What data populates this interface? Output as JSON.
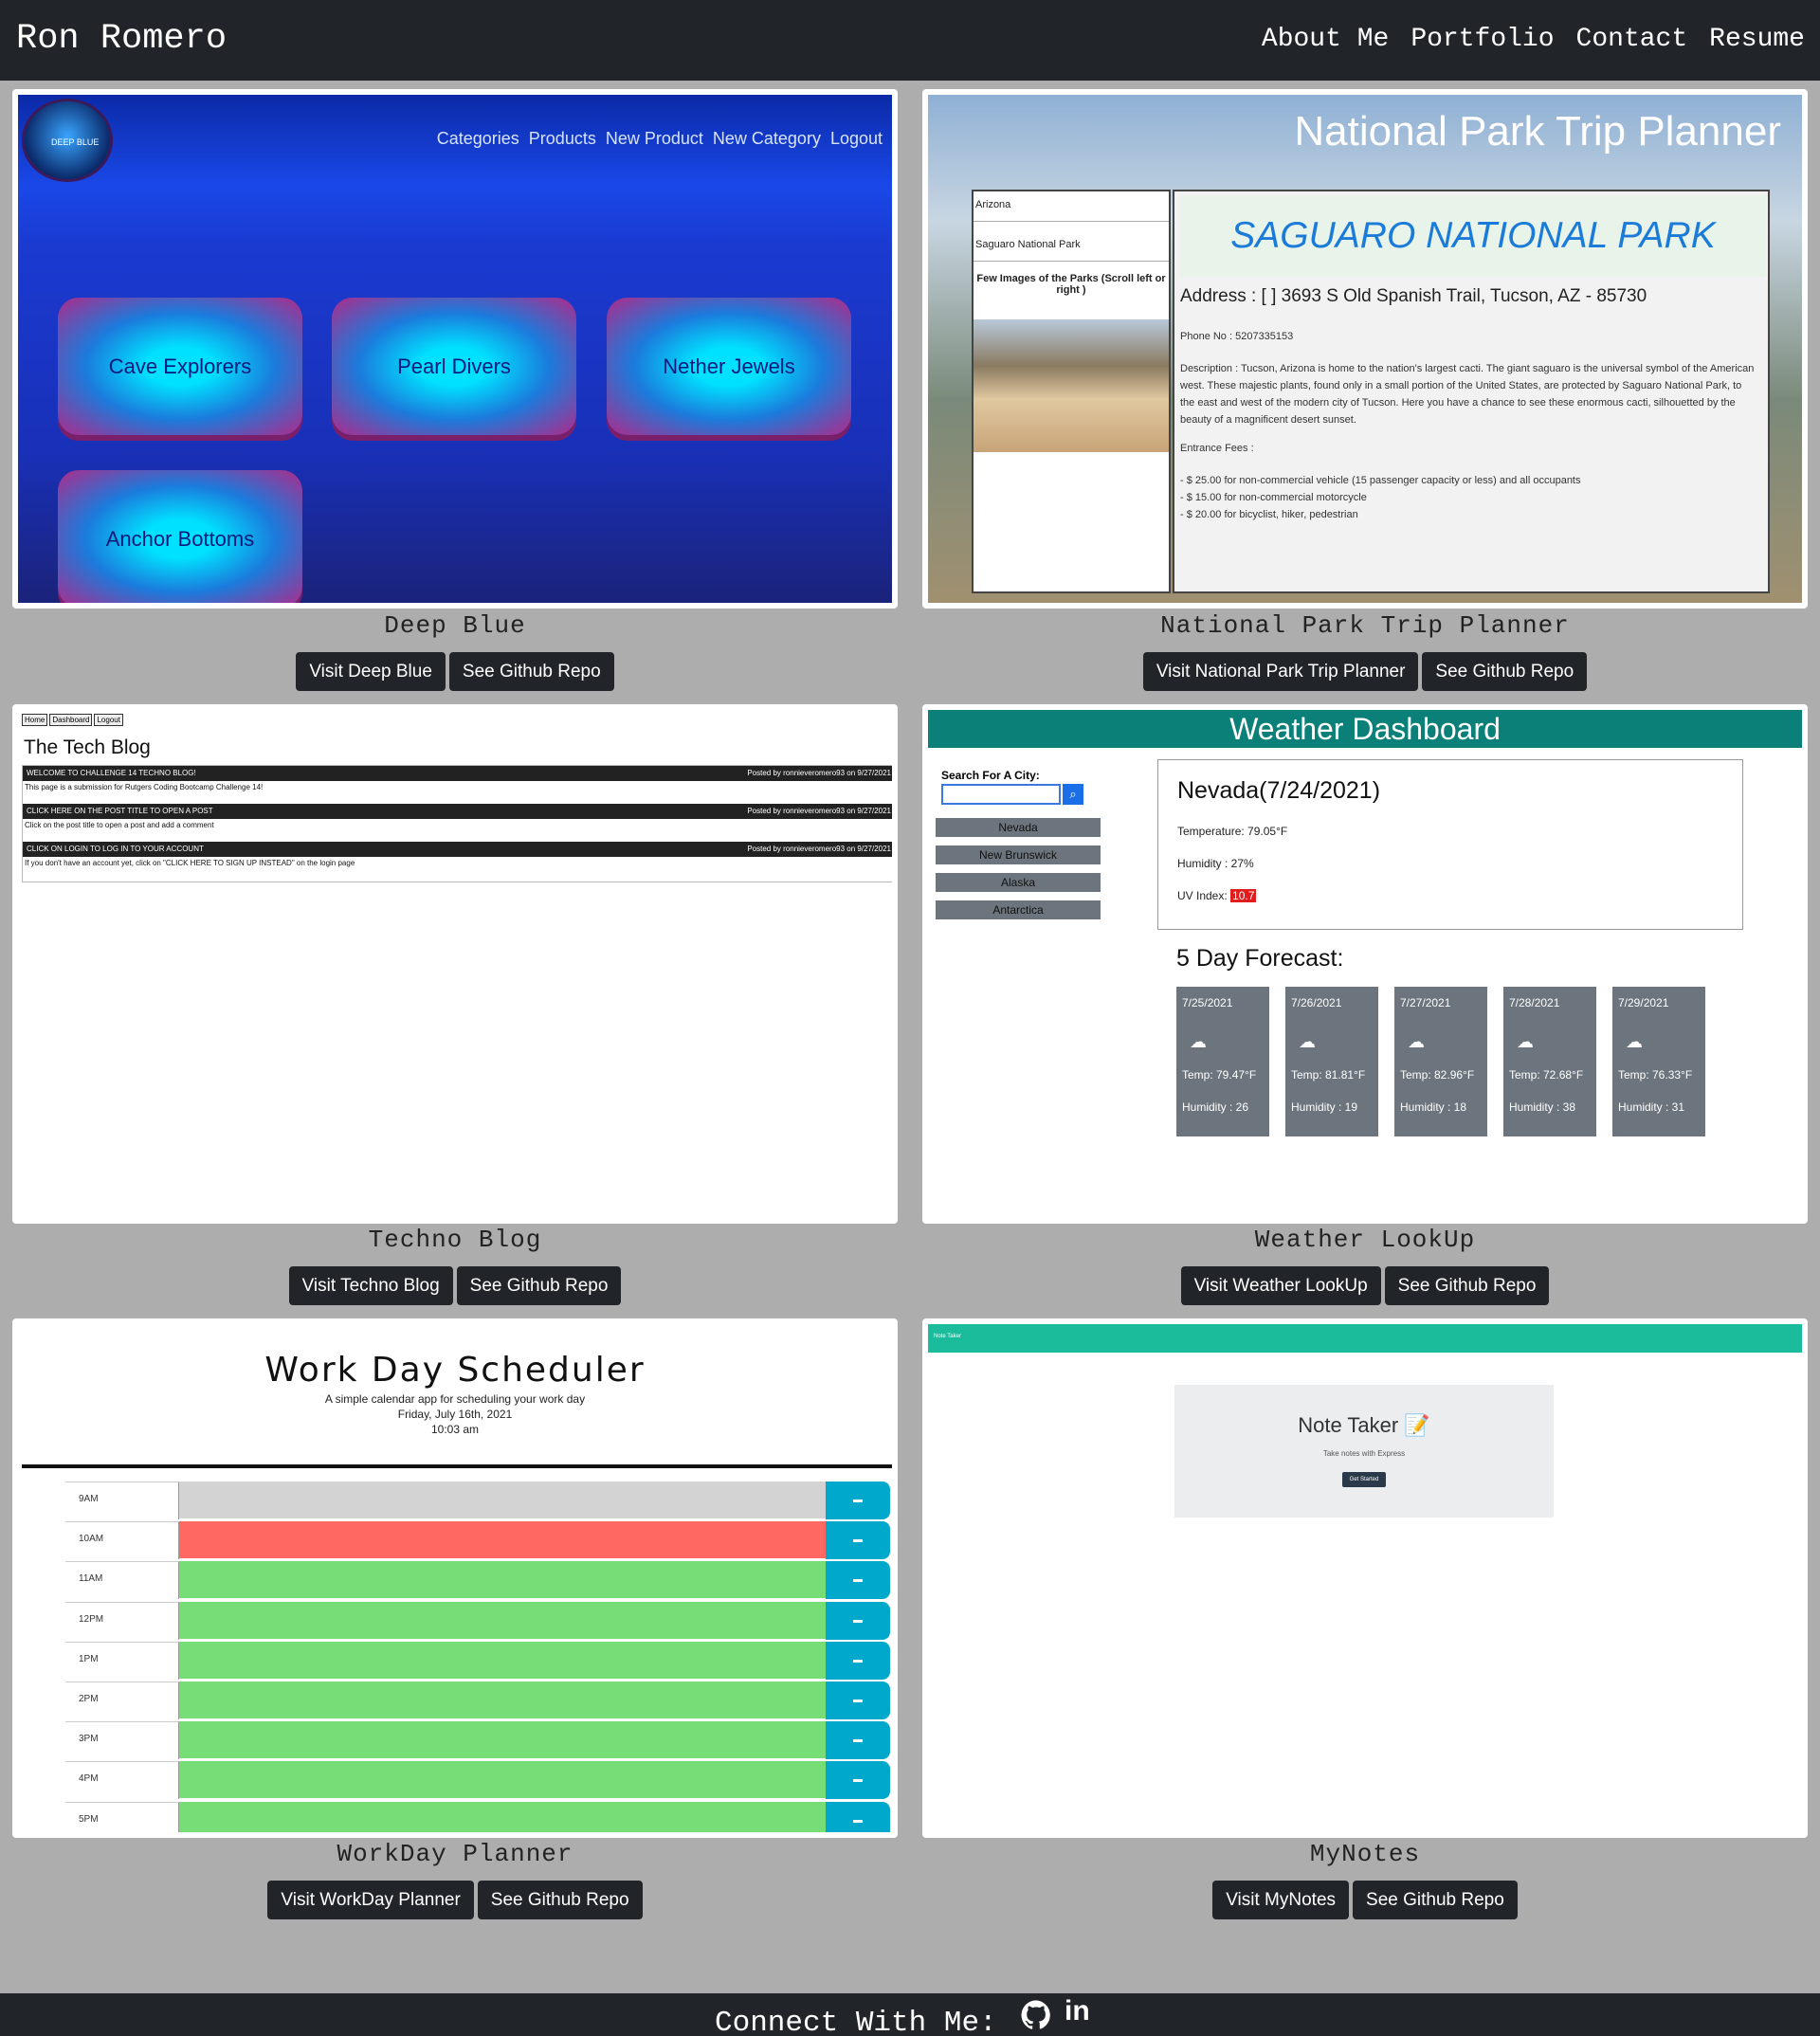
{
  "nav": {
    "brand": "Ron Romero",
    "links": [
      "About Me",
      "Portfolio",
      "Contact",
      "Resume"
    ]
  },
  "projects": [
    {
      "title": "Deep Blue",
      "visit": "Visit Deep Blue",
      "repo": "See Github Repo"
    },
    {
      "title": "National Park Trip Planner",
      "visit": "Visit National Park Trip Planner",
      "repo": "See Github Repo"
    },
    {
      "title": "Techno Blog",
      "visit": "Visit Techno Blog",
      "repo": "See Github Repo"
    },
    {
      "title": "Weather LookUp",
      "visit": "Visit Weather LookUp",
      "repo": "See Github Repo"
    },
    {
      "title": "WorkDay Planner",
      "visit": "Visit WorkDay Planner",
      "repo": "See Github Repo"
    },
    {
      "title": "MyNotes",
      "visit": "Visit MyNotes",
      "repo": "See Github Repo"
    }
  ],
  "deep_blue": {
    "logo": "DEEP BLUE",
    "nav": [
      "Categories",
      "Products",
      "New Product",
      "New Category",
      "Logout"
    ],
    "tiles": [
      "Cave Explorers",
      "Pearl Divers",
      "Nether Jewels",
      "Anchor Bottoms"
    ]
  },
  "national_park": {
    "heading": "National Park Trip Planner",
    "state": "Arizona",
    "park": "Saguaro National Park",
    "images_caption": "Few Images of the Parks (Scroll left or right )",
    "name": "SAGUARO NATIONAL PARK",
    "address": "Address : [ ] 3693 S Old Spanish Trail, Tucson, AZ - 85730",
    "phone": "Phone No : 5207335153",
    "description": "Description : Tucson, Arizona is home to the nation's largest cacti. The giant saguaro is the universal symbol of the American west. These majestic plants, found only in a small portion of the United States, are protected by Saguaro National Park, to the east and west of the modern city of Tucson. Here you have a chance to see these enormous cacti, silhouetted by the beauty of a magnificent desert sunset.",
    "fees_label": "Entrance Fees :",
    "fees": [
      "- $ 25.00 for non-commercial vehicle (15 passenger capacity or less) and all occupants",
      "- $ 15.00 for non-commercial motorcycle",
      "- $ 20.00 for bicyclist, hiker, pedestrian"
    ]
  },
  "techno_blog": {
    "nav": [
      "Home",
      "Dashboard",
      "Logout"
    ],
    "heading": "The Tech Blog",
    "posts": [
      {
        "title": "WELCOME TO CHALLENGE 14 TECHNO BLOG!",
        "meta": "Posted by ronnieveromero93 on 9/27/2021",
        "body": "This page is a submission for Rutgers Coding Bootcamp Challenge 14!"
      },
      {
        "title": "CLICK HERE ON THE POST TITLE TO OPEN A POST",
        "meta": "Posted by ronnieveromero93 on 9/27/2021",
        "body": "Click on the post title to open a post and add a comment"
      },
      {
        "title": "CLICK ON LOGIN TO LOG IN TO YOUR ACCOUNT",
        "meta": "Posted by ronnieveromero93 on 9/27/2021",
        "body": "If you don't have an account yet, click on \"CLICK HERE TO SIGN UP INSTEAD\" on the login page"
      }
    ]
  },
  "weather": {
    "heading": "Weather Dashboard",
    "search_label": "Search For A City:",
    "cities": [
      "Nevada",
      "New Brunswick",
      "Alaska",
      "Antarctica"
    ],
    "current_title": "Nevada(7/24/2021)",
    "temperature": "Temperature: 79.05°F",
    "humidity": "Humidity : 27%",
    "uv_label": "UV Index:",
    "uv_value": "10.7",
    "forecast_heading": "5 Day Forecast:",
    "forecast": [
      {
        "date": "7/25/2021",
        "temp": "Temp: 79.47°F",
        "hum": "Humidity : 26"
      },
      {
        "date": "7/26/2021",
        "temp": "Temp: 81.81°F",
        "hum": "Humidity : 19"
      },
      {
        "date": "7/27/2021",
        "temp": "Temp: 82.96°F",
        "hum": "Humidity : 18"
      },
      {
        "date": "7/28/2021",
        "temp": "Temp: 72.68°F",
        "hum": "Humidity : 38"
      },
      {
        "date": "7/29/2021",
        "temp": "Temp: 76.33°F",
        "hum": "Humidity : 31"
      }
    ]
  },
  "workday": {
    "heading": "Work Day Scheduler",
    "subtitle": "A simple calendar app for scheduling your work day",
    "date": "Friday, July 16th, 2021",
    "time": "10:03 am",
    "hours": [
      "9AM",
      "10AM",
      "11AM",
      "12PM",
      "1PM",
      "2PM",
      "3PM",
      "4PM",
      "5PM"
    ],
    "colors": {
      "past": "#d3d3d3",
      "present": "#ff6961",
      "future": "#77dd77"
    }
  },
  "mynotes": {
    "bar": "Note Taker",
    "title": "Note Taker 📝",
    "subtitle": "Take notes with Express",
    "button": "Get Started"
  },
  "footer": {
    "text": "Connect With Me:"
  }
}
